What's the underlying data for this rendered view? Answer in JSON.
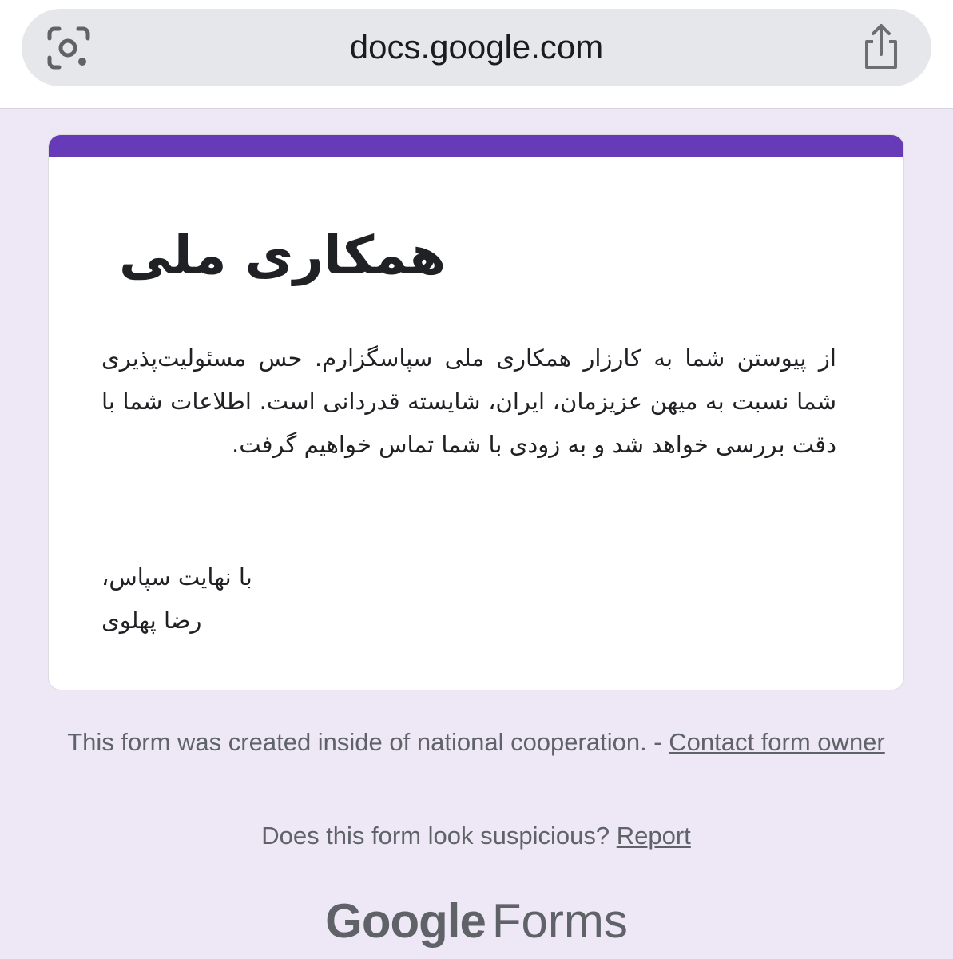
{
  "browser": {
    "url": "docs.google.com",
    "left_icon": "lens-icon",
    "right_icon": "share-icon"
  },
  "form": {
    "accent_color": "#673ab7",
    "background_color": "#ede7f6",
    "title": "همکاری ملی",
    "description": "از پیوستن شما به کارزار همکاری ملی سپاسگزارم. حس مسئولیت‌پذیری شما نسبت به میهن عزیزمان، ایران، شایسته قدردانی است. اطلاعات شما با دقت بررسی خواهد شد و به زودی با شما تماس خواهیم گرفت.",
    "closing": "با نهایت سپاس،",
    "signature": "رضا پهلوی"
  },
  "footer": {
    "created_text": "This form was created inside of national cooperation. - ",
    "contact_link": "Contact form owner",
    "suspicious_text": "Does this form look suspicious? ",
    "report_link": "Report",
    "brand_google": "Google",
    "brand_forms": "Forms"
  }
}
